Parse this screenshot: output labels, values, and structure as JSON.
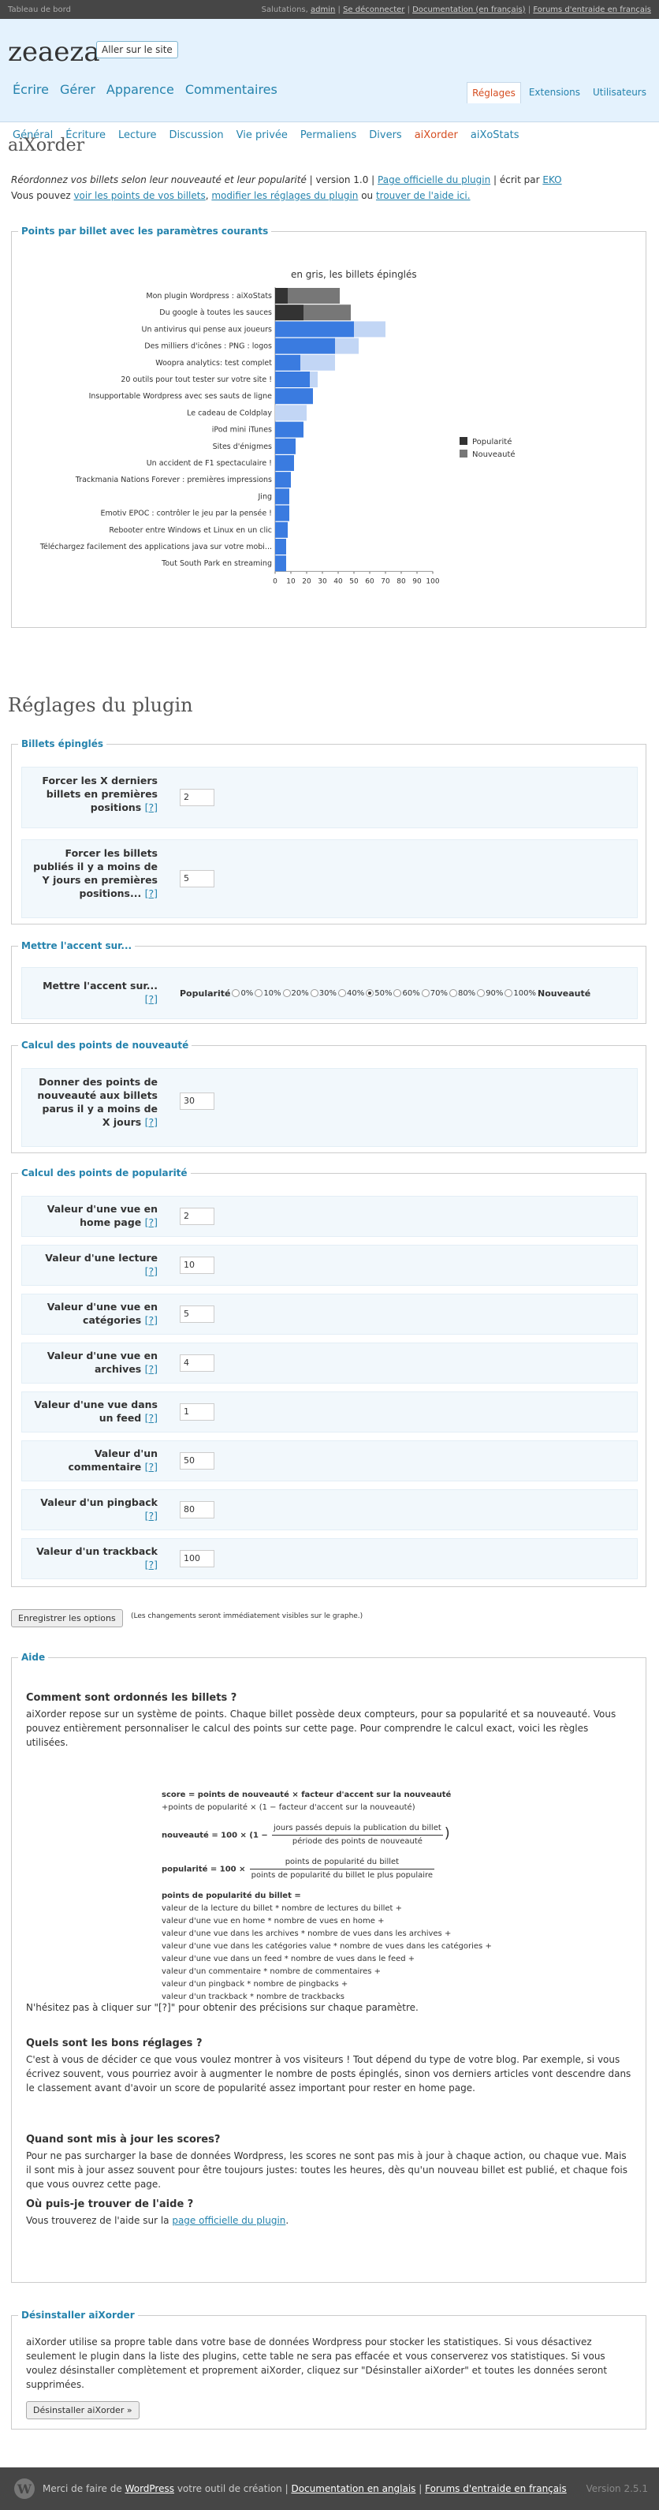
{
  "topbar": {
    "left": "Tableau de bord",
    "greeting": "Salutations,",
    "user": "admin",
    "logout": "Se déconnecter",
    "doc": "Documentation (en français)",
    "forums": "Forums d'entraide en français"
  },
  "header": {
    "blog_title": "zeaeza",
    "visit_button": "Aller sur le site"
  },
  "main_menu": [
    "Écrire",
    "Gérer",
    "Apparence",
    "Commentaires"
  ],
  "right_menu": [
    "Réglages",
    "Extensions",
    "Utilisateurs"
  ],
  "sub_menu": [
    "Général",
    "Écriture",
    "Lecture",
    "Discussion",
    "Vie privée",
    "Permaliens",
    "Divers",
    "aiXorder",
    "aiXoStats"
  ],
  "page_title": "aiXorder",
  "intro": {
    "line1_italic": "Réordonnez vos billets selon leur nouveauté et leur popularité",
    "line1_version": " | version 1.0 | ",
    "line1_link": "Page officielle du plugin",
    "line1_by": " | écrit par ",
    "line1_author": "EKO",
    "line2_pre": "Vous pouvez ",
    "line2_link1": "voir les points de vos billets",
    "line2_sep1": ", ",
    "line2_link2": "modifier les réglages du plugin",
    "line2_sep2": " ou ",
    "line2_link3": "trouver de l'aide ici."
  },
  "chart_legend_title": "Points par billet avec les paramètres courants",
  "chart_data": {
    "type": "bar",
    "title": "en gris, les billets épinglés",
    "orientation": "horizontal",
    "stacked": true,
    "categories": [
      "Mon plugin Wordpress : aiXoStats",
      "Du google à toutes les sauces",
      "Un antivirus qui pense aux joueurs",
      "Des milliers d'icônes : PNG : logos",
      "Woopra analytics: test complet",
      "20 outils pour tout tester sur votre site !",
      "Insupportable Wordpress avec ses sauts de ligne",
      "Le cadeau de Coldplay",
      "iPod mini iTunes",
      "Sites d'énigmes",
      "Un accident de F1 spectaculaire !",
      "Trackmania Nations Forever : premières impressions",
      "Jing",
      "Emotiv EPOC : contrôler le jeu par la pensée !",
      "Rebooter entre Windows et Linux en un clic",
      "Téléchargez facilement des applications java sur votre mobi...",
      "Tout South Park en streaming"
    ],
    "series": [
      {
        "name": "Popularité",
        "values": [
          8,
          18,
          50,
          38,
          16,
          22,
          24,
          0,
          18,
          13,
          12,
          10,
          9,
          9,
          8,
          7,
          7
        ]
      },
      {
        "name": "Nouveauté",
        "values": [
          33,
          30,
          20,
          15,
          22,
          5,
          0,
          20,
          0,
          0,
          0,
          0,
          0,
          0,
          0,
          0,
          0
        ]
      }
    ],
    "pinned": [
      true,
      true,
      false,
      false,
      false,
      false,
      false,
      false,
      false,
      false,
      false,
      false,
      false,
      false,
      false,
      false,
      false
    ],
    "xticks": [
      0,
      10,
      20,
      30,
      40,
      50,
      60,
      70,
      80,
      90,
      100
    ],
    "xlim": [
      0,
      100
    ],
    "legend_position": "right",
    "colors": {
      "Popularité": "#333333",
      "Nouveauté": "#777777",
      "pop_normal": "#3a7be0",
      "nouv_normal": "#c2d6f5"
    }
  },
  "plugin_settings_title": "Réglages du plugin",
  "pinned_section": {
    "legend": "Billets épinglés",
    "fields": [
      {
        "label": "Forcer les X derniers billets en premières positions",
        "help": "[?]",
        "value": "2"
      },
      {
        "label": "Forcer les billets publiés il y a moins de Y jours en premières positions...",
        "help": "[?]",
        "value": "5"
      }
    ]
  },
  "accent_section": {
    "legend": "Mettre l'accent sur...",
    "label": "Mettre l'accent sur...",
    "help": "[?]",
    "left": "Popularité",
    "right": "Nouveauté",
    "options": [
      "0%",
      "10%",
      "20%",
      "30%",
      "40%",
      "50%",
      "60%",
      "70%",
      "80%",
      "90%",
      "100%"
    ],
    "selected": "50%"
  },
  "novelty_section": {
    "legend": "Calcul des points de nouveauté",
    "label": "Donner des points de nouveauté aux billets parus il y a moins de X jours",
    "help": "[?]",
    "value": "30"
  },
  "popularity_section": {
    "legend": "Calcul des points de popularité",
    "fields": [
      {
        "label": "Valeur d'une vue en home page",
        "help": "[?]",
        "value": "2"
      },
      {
        "label": "Valeur d'une lecture",
        "help": "[?]",
        "value": "10"
      },
      {
        "label": "Valeur d'une vue en catégories",
        "help": "[?]",
        "value": "5"
      },
      {
        "label": "Valeur d'une vue en archives",
        "help": "[?]",
        "value": "4"
      },
      {
        "label": "Valeur d'une vue dans un feed",
        "help": "[?]",
        "value": "1"
      },
      {
        "label": "Valeur d'un commentaire",
        "help": "[?]",
        "value": "50"
      },
      {
        "label": "Valeur d'un pingback",
        "help": "[?]",
        "value": "80"
      },
      {
        "label": "Valeur d'un trackback",
        "help": "[?]",
        "value": "100"
      }
    ]
  },
  "save": {
    "button": "Enregistrer les options",
    "note": "(Les changements seront immédiatement visibles sur le graphe.)"
  },
  "help": {
    "legend": "Aide",
    "q1": "Comment sont ordonnés les billets ?",
    "a1": "aiXorder repose sur un système de points. Chaque billet possède deux compteurs, pour sa popularité et sa nouveauté. Vous pouvez entièrement personnaliser le calcul des points sur cette page. Pour comprendre le calcul exact, voici les règles utilisées.",
    "f1": "score = points de nouveauté × facteur d'accent sur la nouveauté",
    "f1b": "+points de popularité × (1 − facteur d'accent sur la nouveauté)",
    "f2_left": "nouveauté = 100 × (1 −",
    "f2_top": "jours passés depuis la publication du billet",
    "f2_bottom": "période des points de nouveauté",
    "f2_right": ")",
    "f3_left": "popularité = 100 ×",
    "f3_top": "points de popularité du billet",
    "f3_bottom": "points de popularité du billet le plus populaire",
    "f4_title": "points de popularité du billet =",
    "f4_lines": [
      "valeur de la lecture du billet * nombre de lectures du billet +",
      "valeur d'une vue en home * nombre de vues en home +",
      "valeur d'une vue dans les archives * nombre de vues dans les archives +",
      "valeur d'une vue dans les catégories value * nombre de vues dans les catégories +",
      "valeur d'une vue dans un feed * nombre de vues dans le feed +",
      "valeur d'un commentaire * nombre de commentaires +",
      "valeur d'un pingback * nombre de pingbacks +",
      "valeur d'un trackback * nombre de trackbacks"
    ],
    "after_formula": "N'hésitez pas à cliquer sur \"[?]\" pour obtenir des précisions sur chaque paramètre.",
    "q2": "Quels sont les bons réglages ?",
    "a2": "C'est à vous de décider ce que vous voulez montrer à vos visiteurs ! Tout dépend du type de votre blog. Par exemple, si vous écrivez souvent, vous pourriez avoir à augmenter le nombre de posts épinglés, sinon vos derniers articles vont descendre dans le classement avant d'avoir un score de popularité assez important pour rester en home page.",
    "q3": "Quand sont mis à jour les scores?",
    "a3": "Pour ne pas surcharger la base de données Wordpress, les scores ne sont pas mis à jour à chaque action, ou chaque vue. Mais il sont mis à jour assez souvent pour être toujours justes: toutes les heures, dès qu'un nouveau billet est publié, et chaque fois que vous ouvrez cette page.",
    "q4": "Où puis-je trouver de l'aide ?",
    "a4_pre": "Vous trouverez de l'aide sur la ",
    "a4_link": "page officielle du plugin",
    "a4_post": "."
  },
  "uninstall": {
    "legend": "Désinstaller aiXorder",
    "text": "aiXorder utilise sa propre table dans votre base de données Wordpress pour stocker les statistiques. Si vous désactivez seulement le plugin dans la liste des plugins, cette table ne sera pas effacée et vous conserverez vos statistiques. Si vous voulez désinstaller complètement et proprement aiXorder, cliquez sur \"Désinstaller aiXorder\" et toutes les données seront supprimées.",
    "button": "Désinstaller aiXorder »"
  },
  "footer": {
    "pre": "Merci de faire de ",
    "wp": "WordPress",
    "mid": " votre outil de création | ",
    "doc": "Documentation en anglais",
    "sep": " | ",
    "forums": "Forums d'entraide en français",
    "version": "Version 2.5.1"
  }
}
